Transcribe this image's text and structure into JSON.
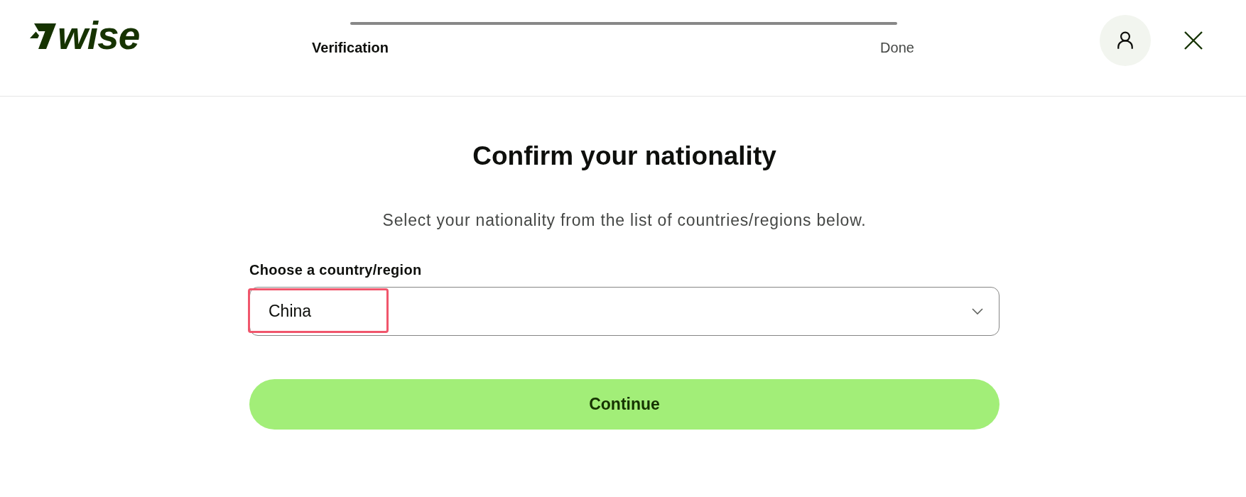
{
  "header": {
    "logo": "wise",
    "steps": [
      {
        "label": "Verification",
        "current": true
      },
      {
        "label": "Done",
        "current": false
      }
    ]
  },
  "main": {
    "title": "Confirm your nationality",
    "subtitle": "Select your nationality from the list of countries/regions below.",
    "country_field": {
      "label": "Choose a country/region",
      "value": "China",
      "highlighted": true
    },
    "continue_button": {
      "label": "Continue"
    }
  }
}
